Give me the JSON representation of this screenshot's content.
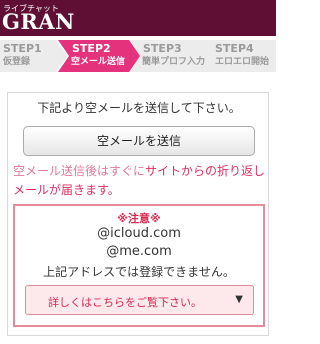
{
  "header": {
    "logo_sub": "ライブチャット",
    "logo_main": "GRAN",
    "bg": "#5e0f33"
  },
  "steps": [
    {
      "num": "STEP1",
      "label": "仮登録",
      "state": "done"
    },
    {
      "num": "STEP2",
      "label": "空メール送信",
      "state": "active"
    },
    {
      "num": "STEP3",
      "label": "簡単プロフ入力",
      "state": "upcoming"
    },
    {
      "num": "STEP4",
      "label": "エロエロ開始",
      "state": "upcoming"
    }
  ],
  "main": {
    "intro": "下記より空メールを送信して下さい。",
    "send_button": "空メールを送信",
    "note_prefix": "空メール送信後はすぐに",
    "note_highlight": "サイトからの折り返",
    "note_suffix": "しメールが届きます。"
  },
  "warning": {
    "title": "※注意※",
    "domain1": "@icloud.com",
    "domain2": "@me.com",
    "message": "上記アドレスでは登録できません。",
    "detail_button": "詳しくはこちらをご覧下さい。",
    "caret_icon": "caret-down-icon"
  },
  "colors": {
    "brand": "#5e0f33",
    "active_step": "#e4327c",
    "accent": "#d8284f",
    "pink_text": "#e07a96"
  }
}
